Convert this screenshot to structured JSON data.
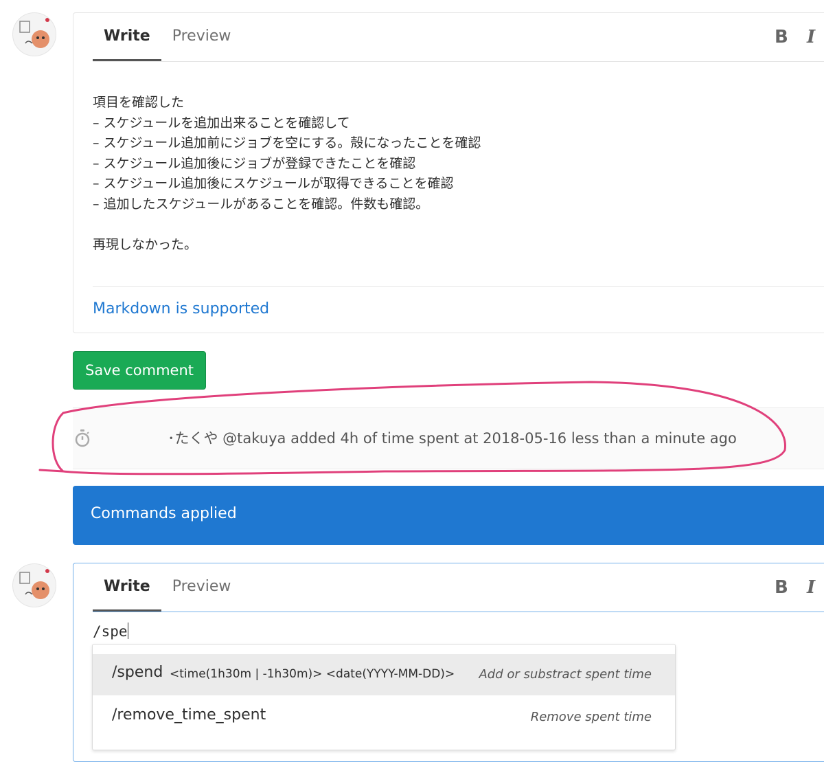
{
  "editor1": {
    "tabs": [
      {
        "label": "Write",
        "active": true
      },
      {
        "label": "Preview",
        "active": false
      }
    ],
    "bold": "B",
    "italic": "I",
    "body_lines": [
      "項目を確認した",
      "– スケジュールを追加出来ることを確認して",
      "– スケジュール追加前にジョブを空にする。殻になったことを確認",
      "– スケジュール追加後にジョブが登録できたことを確認",
      "– スケジュール追加後にスケジュールが取得できることを確認",
      "– 追加したスケジュールがあることを確認。件数も確認。",
      "",
      "再現しなかった。"
    ],
    "markdown_hint": "Markdown is supported"
  },
  "save_button": "Save comment",
  "system_note": {
    "icon": "stopwatch-icon",
    "text": "･たくや @takuya added 4h of time spent at 2018-05-16 less than a minute ago"
  },
  "flash": {
    "text": "Commands applied"
  },
  "editor2": {
    "tabs": [
      {
        "label": "Write",
        "active": true
      },
      {
        "label": "Preview",
        "active": false
      }
    ],
    "bold": "B",
    "italic": "I",
    "input": "/spe"
  },
  "autocomplete": [
    {
      "command": "/spend",
      "params": "<time(1h30m | -1h30m)> <date(YYYY-MM-DD)>",
      "description": "Add or substract spent time",
      "selected": true
    },
    {
      "command": "/remove_time_spent",
      "params": "",
      "description": "Remove spent time",
      "selected": false
    }
  ],
  "colors": {
    "save_button": "#1aaa55",
    "flash_background": "#1f78d1",
    "link": "#1f78d1",
    "annotation_circle": "#e0407b"
  }
}
